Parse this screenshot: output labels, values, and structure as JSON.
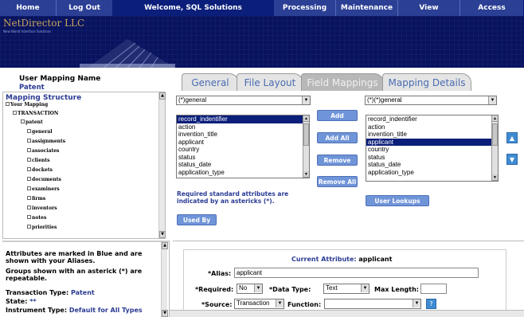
{
  "nav": {
    "home": "Home",
    "logout": "Log Out",
    "welcome": "Welcome, SQL Solutions",
    "processing": "Processing",
    "maintenance": "Maintenance",
    "view": "View",
    "access": "Access"
  },
  "banner": {
    "brand": "NetDirector LLC",
    "tagline": "New World Interface Solutions"
  },
  "mapping": {
    "title": "User Mapping Name",
    "name": "Patent"
  },
  "tabs": [
    "General",
    "File Layout",
    "Field Mappings",
    "Mapping Details"
  ],
  "structure": {
    "title": "Mapping Structure",
    "root": "Your Mapping",
    "transaction": "TRANSACTION",
    "patent": "patent",
    "children": [
      "general",
      "assignments",
      "associates",
      "clients",
      "dockets",
      "documents",
      "examiners",
      "firms",
      "inventors",
      "notes",
      "priorities"
    ]
  },
  "left_select": {
    "value": "(*)general"
  },
  "right_select": {
    "value": "(*)(*)general"
  },
  "left_list": [
    "record_indentifier",
    "action",
    "invention_title",
    "applicant",
    "country",
    "status",
    "status_date",
    "application_type"
  ],
  "right_list": [
    "record_indentifier",
    "action",
    "invention_title",
    "applicant",
    "country",
    "status",
    "status_date",
    "application_type"
  ],
  "buttons": {
    "add": "Add",
    "add_all": "Add All",
    "remove": "Remove",
    "remove_all": "Remove All",
    "user_lookups": "User Lookups",
    "used_by": "Used By",
    "help": "?"
  },
  "required_note": "Required standard attributes are indicated by an astericks (*).",
  "info": {
    "line1": "Attributes are marked in Blue and are shown with your Aliases.",
    "line2": "Groups shown with an asterick (*) are repeatable.",
    "transaction_label": "Transaction Type:",
    "transaction_value": "Patent",
    "state_label": "State:",
    "state_value": "**",
    "instrument_label": "Instrument Type:",
    "instrument_value": "Default for All Types"
  },
  "attribute": {
    "current_label": "Current Attribute:",
    "current_value": "applicant",
    "alias_label": "*Alias:",
    "alias_value": "applicant",
    "required_label": "*Required:",
    "required_value": "No",
    "datatype_label": "*Data Type:",
    "datatype_value": "Text",
    "maxlength_label": "Max Length:",
    "maxlength_value": "",
    "source_label": "*Source:",
    "source_value": "Transaction",
    "function_label": "Function:",
    "function_value": ""
  },
  "colors": {
    "nav_bg": "#0a1e7a",
    "banner_bg": "#08135c",
    "label_blue": "#2a3b93",
    "button_blue": "#6f94d8",
    "selection": "#0a1e7a"
  }
}
